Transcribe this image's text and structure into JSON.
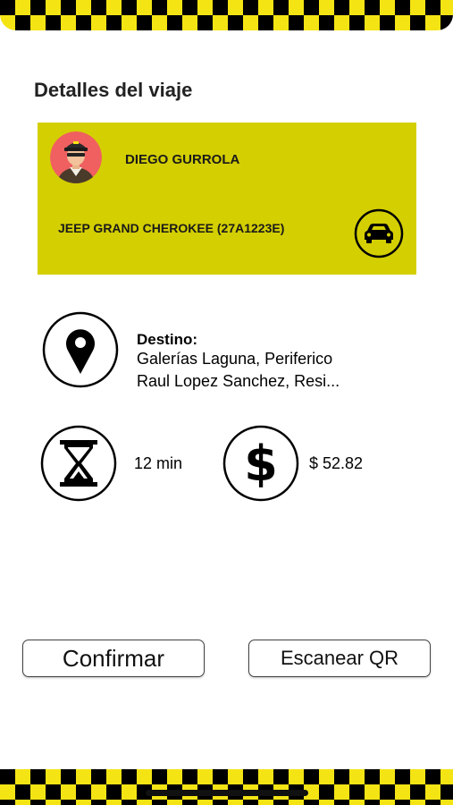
{
  "page": {
    "title": "Detalles del viaje"
  },
  "driver": {
    "name": "DIEGO GURROLA",
    "vehicle": "JEEP GRAND CHEROKEE (27A1223E)",
    "avatar_icon": "taxi-driver-avatar",
    "car_icon": "car-icon"
  },
  "destination": {
    "label": "Destino:",
    "line1": "Galerías Laguna, Periferico",
    "line2": "Raul Lopez Sanchez, Resi...",
    "icon": "location-pin-icon"
  },
  "trip": {
    "duration": "12 min",
    "duration_icon": "hourglass-icon",
    "price": "$ 52.82",
    "price_icon": "dollar-icon"
  },
  "actions": {
    "confirm": "Confirmar",
    "scan_qr": "Escanear QR"
  },
  "colors": {
    "card": "#d4cf00",
    "checker_yellow": "#f4e414",
    "checker_black": "#000000"
  }
}
